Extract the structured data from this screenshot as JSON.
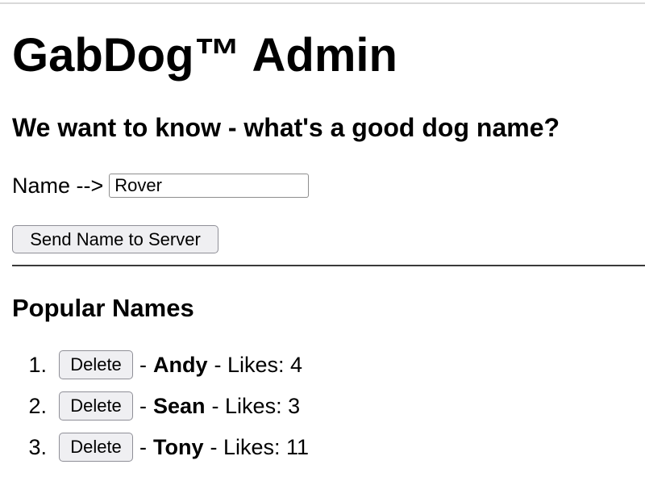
{
  "header": {
    "title": "GabDog™ Admin",
    "question": "We want to know - what's a good dog name?"
  },
  "form": {
    "name_label": "Name -->",
    "name_value": "Rover",
    "send_label": "Send Name to Server"
  },
  "popular": {
    "heading": "Popular Names",
    "delete_label": "Delete",
    "separator": "-",
    "likes_prefix": "- Likes:",
    "items": [
      {
        "number": "1.",
        "name": "Andy",
        "likes": "4"
      },
      {
        "number": "2.",
        "name": "Sean",
        "likes": "3"
      },
      {
        "number": "3.",
        "name": "Tony",
        "likes": "11"
      }
    ]
  }
}
